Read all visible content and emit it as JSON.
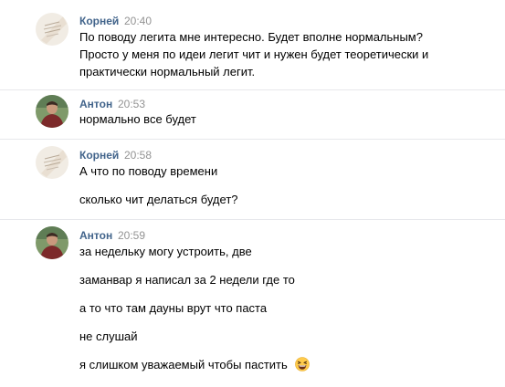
{
  "messages": [
    {
      "author": "Корней",
      "time": "20:40",
      "avatar_icon": "avatar-korney",
      "lines": [
        "По поводу легита мне интересно. Будет вполне нормальным?",
        "Просто у меня по идеи легит чит и нужен будет теоретически и",
        "практически нормальный легит."
      ]
    },
    {
      "author": "Антон",
      "time": "20:53",
      "avatar_icon": "avatar-anton",
      "lines": [
        "нормально все будет"
      ]
    },
    {
      "author": "Корней",
      "time": "20:58",
      "avatar_icon": "avatar-korney",
      "lines": [
        "А что по поводу времени",
        "сколько чит делаться будет?"
      ]
    },
    {
      "author": "Антон",
      "time": "20:59",
      "avatar_icon": "avatar-anton",
      "lines": [
        "за недельку могу устроить, две",
        "заманвар я написал за 2 недели где то",
        "а то что там дауны врут что паста",
        "не слушай",
        "я слишком уважаемый чтобы пастить"
      ],
      "emoji_icon": "laughing-emoji-icon"
    }
  ],
  "colors": {
    "author_link": "#42648b",
    "timestamp": "#939393",
    "separator": "#e7e8ec",
    "text": "#000000"
  }
}
